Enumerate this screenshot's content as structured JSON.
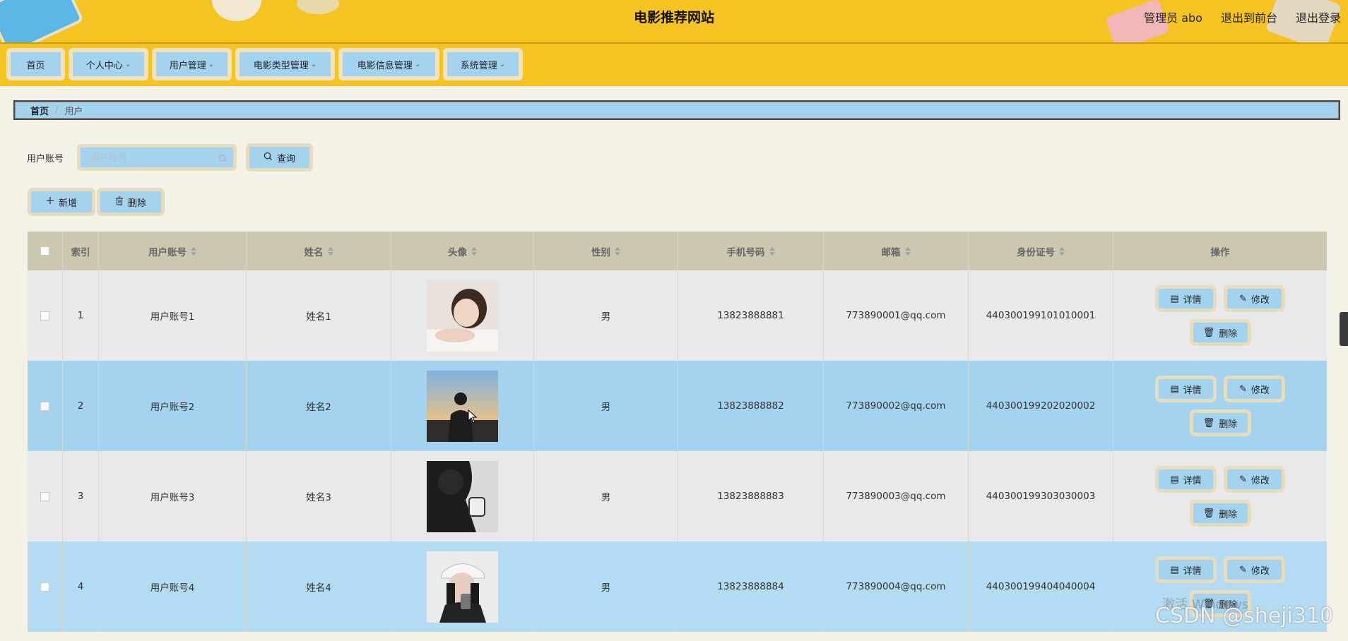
{
  "header": {
    "site_title": "电影推荐网站",
    "admin_label": "管理员 abo",
    "back_front_label": "退出到前台",
    "logout_label": "退出登录"
  },
  "nav": {
    "items": [
      {
        "label": "首页",
        "has_dropdown": false
      },
      {
        "label": "个人中心",
        "has_dropdown": true
      },
      {
        "label": "用户管理",
        "has_dropdown": true
      },
      {
        "label": "电影类型管理",
        "has_dropdown": true
      },
      {
        "label": "电影信息管理",
        "has_dropdown": true
      },
      {
        "label": "系统管理",
        "has_dropdown": true
      }
    ]
  },
  "breadcrumb": {
    "home": "首页",
    "separator": "/",
    "current": "用户"
  },
  "search": {
    "label": "用户账号",
    "placeholder": "用户账号",
    "value": "",
    "query_button": "查询"
  },
  "actions": {
    "add_label": "新增",
    "delete_label": "删除"
  },
  "table": {
    "headers": {
      "index": "索引",
      "account": "用户账号",
      "name": "姓名",
      "avatar": "头像",
      "gender": "性别",
      "phone": "手机号码",
      "email": "邮箱",
      "id_card": "身份证号",
      "operation": "操作"
    },
    "rows": [
      {
        "index": "1",
        "account": "用户账号1",
        "name": "姓名1",
        "gender": "男",
        "phone": "13823888881",
        "email": "773890001@qq.com",
        "id_card": "440300199101010001"
      },
      {
        "index": "2",
        "account": "用户账号2",
        "name": "姓名2",
        "gender": "男",
        "phone": "13823888882",
        "email": "773890002@qq.com",
        "id_card": "440300199202020002"
      },
      {
        "index": "3",
        "account": "用户账号3",
        "name": "姓名3",
        "gender": "男",
        "phone": "13823888883",
        "email": "773890003@qq.com",
        "id_card": "440300199303030003"
      },
      {
        "index": "4",
        "account": "用户账号4",
        "name": "姓名4",
        "gender": "男",
        "phone": "13823888884",
        "email": "773890004@qq.com",
        "id_card": "440300199404040004"
      }
    ],
    "row_actions": {
      "detail": "详情",
      "edit": "修改",
      "delete": "删除"
    }
  },
  "overlay": {
    "windows_watermark": "激活 Windows",
    "csdn_watermark": "CSDN @sheji310"
  },
  "colors": {
    "header_bg": "#f5c322",
    "button_bg": "#a4d3f0",
    "table_head": "#cbc7b1",
    "page_bg": "#f4f1e6"
  }
}
